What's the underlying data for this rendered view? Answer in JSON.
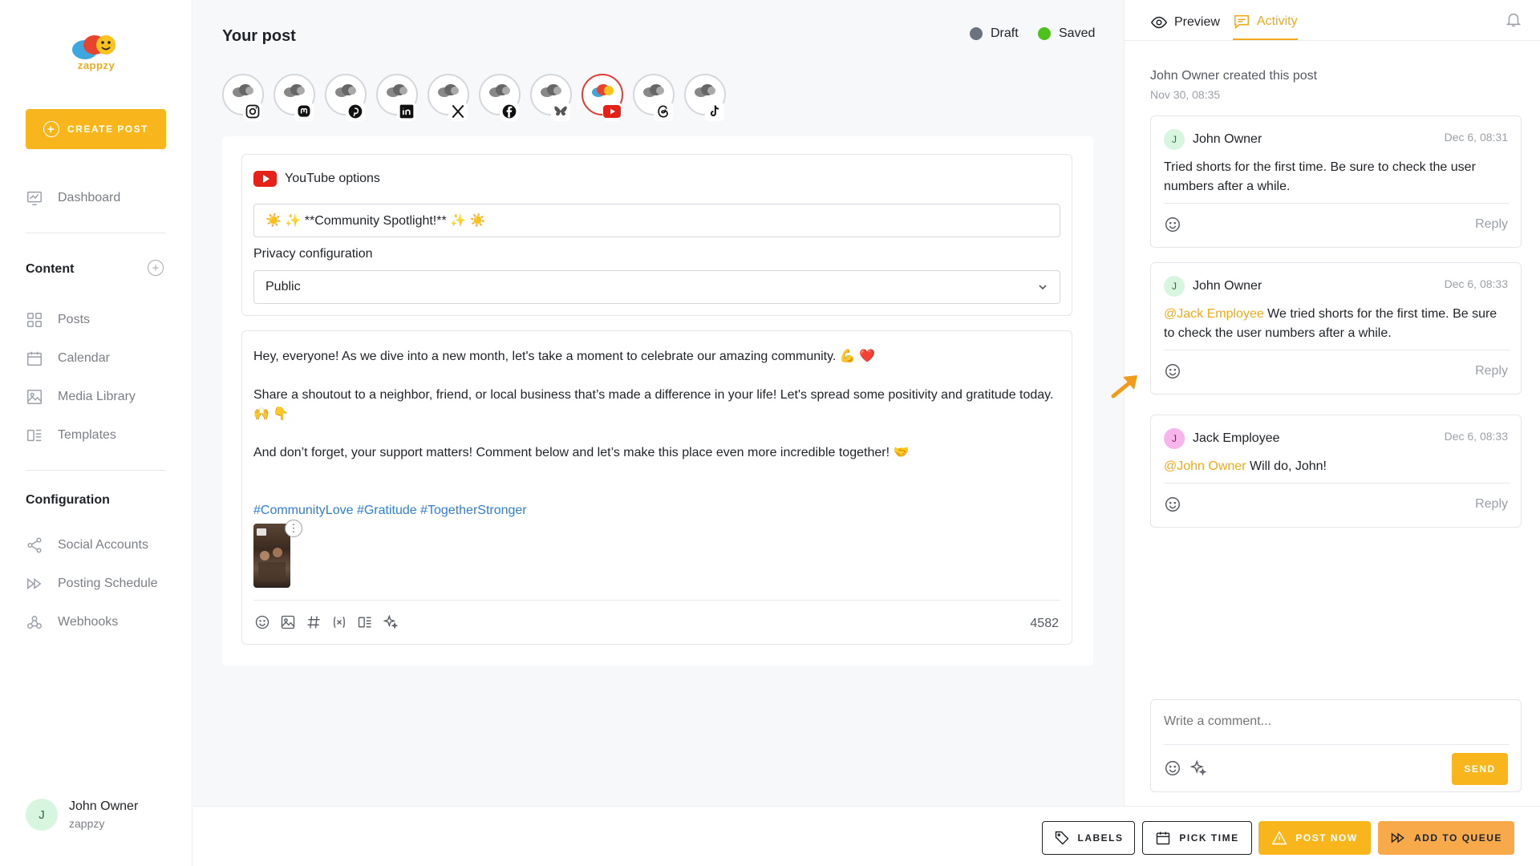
{
  "app": {
    "brand": "zappzy"
  },
  "sidebar": {
    "create_label": "CREATE POST",
    "dashboard": "Dashboard",
    "content_title": "Content",
    "content_items": [
      "Posts",
      "Calendar",
      "Media Library",
      "Templates"
    ],
    "config_title": "Configuration",
    "config_items": [
      "Social Accounts",
      "Posting Schedule",
      "Webhooks"
    ],
    "user": {
      "initial": "J",
      "name": "John Owner",
      "org": "zappzy"
    }
  },
  "post": {
    "title": "Your post",
    "status_draft": "Draft",
    "status_saved": "Saved",
    "accounts": [
      "instagram",
      "mastodon",
      "pinterest",
      "linkedin",
      "x",
      "facebook",
      "bluesky",
      "youtube",
      "threads",
      "tiktok"
    ],
    "active_account": "youtube",
    "youtube_options_label": "YouTube options",
    "youtube_title": "☀️ ✨ **Community Spotlight!** ✨ ☀️",
    "privacy_label": "Privacy configuration",
    "privacy_value": "Public",
    "body": {
      "p1": "Hey, everyone! As we dive into a new month, let's take a moment to celebrate our amazing community. 💪 ❤️",
      "p2": "Share a shoutout to a neighbor, friend, or local business that’s made a difference in your life! Let's spread some positivity and gratitude today. 🙌 👇",
      "p3": "And don’t forget, your support matters! Comment below and let’s make this place even more incredible together! 🤝",
      "hashtags": "#CommunityLove #Gratitude #TogetherStronger"
    },
    "char_count": "4582"
  },
  "footer": {
    "labels": "LABELS",
    "pick_time": "PICK TIME",
    "post_now": "POST NOW",
    "add_to_queue": "ADD TO QUEUE"
  },
  "activity": {
    "tab_preview": "Preview",
    "tab_activity": "Activity",
    "created_text": "John Owner created this post",
    "created_date": "Nov 30, 08:35",
    "comments": [
      {
        "initial": "J",
        "author": "John Owner",
        "date": "Dec 6, 08:31",
        "mention": "",
        "text": "Tried shorts for the first time. Be sure to check the user numbers after a while.",
        "reply": "Reply",
        "avatar_bg": "#d8f5e0",
        "avatar_fg": "#2c6b3f"
      },
      {
        "initial": "J",
        "author": "John Owner",
        "date": "Dec 6, 08:33",
        "mention": "@Jack Employee",
        "text": " We tried shorts for the first time. Be sure to check the user numbers after a while.",
        "reply": "Reply",
        "avatar_bg": "#d8f5e0",
        "avatar_fg": "#2c6b3f"
      },
      {
        "initial": "J",
        "author": "Jack Employee",
        "date": "Dec 6, 08:33",
        "mention": "@John Owner",
        "text": " Will do, John!",
        "reply": "Reply",
        "avatar_bg": "#f7b5ec",
        "avatar_fg": "#7a1d6c"
      }
    ],
    "composer_placeholder": "Write a comment...",
    "send_label": "SEND"
  },
  "colors": {
    "accent": "#f9b61c",
    "draft_dot": "#6b7280",
    "saved_dot": "#4cc21a",
    "queue": "#f8a94a",
    "youtube": "#e62117"
  }
}
